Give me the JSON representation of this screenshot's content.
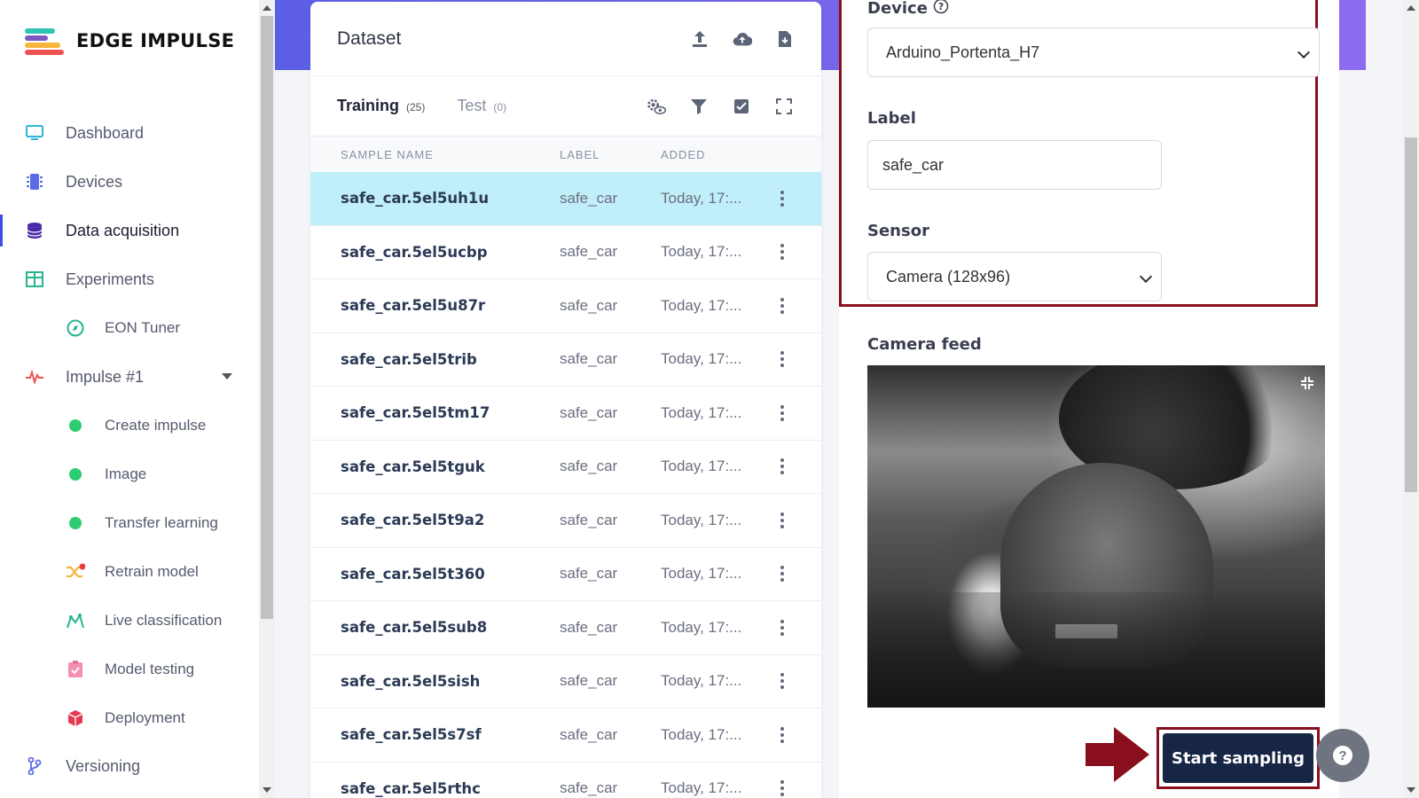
{
  "app": {
    "name": "EDGE IMPULSE"
  },
  "sidebar": {
    "items": [
      {
        "label": "Dashboard",
        "icon": "monitor-icon"
      },
      {
        "label": "Devices",
        "icon": "chip-icon"
      },
      {
        "label": "Data acquisition",
        "icon": "database-icon",
        "active": true
      },
      {
        "label": "Experiments",
        "icon": "table-grid-icon"
      },
      {
        "label": "EON Tuner",
        "icon": "compass-icon"
      },
      {
        "label": "Impulse #1",
        "icon": "pulse-icon"
      },
      {
        "label": "Create impulse",
        "icon": "green-dot-icon"
      },
      {
        "label": "Image",
        "icon": "green-dot-icon"
      },
      {
        "label": "Transfer learning",
        "icon": "green-dot-icon"
      },
      {
        "label": "Retrain model",
        "icon": "shuffle-icon"
      },
      {
        "label": "Live classification",
        "icon": "live-icon"
      },
      {
        "label": "Model testing",
        "icon": "clipboard-check-icon"
      },
      {
        "label": "Deployment",
        "icon": "cube-icon"
      },
      {
        "label": "Versioning",
        "icon": "branch-icon"
      }
    ]
  },
  "dataset": {
    "title": "Dataset",
    "tabs": [
      {
        "label": "Training",
        "count": "(25)"
      },
      {
        "label": "Test",
        "count": "(0)"
      }
    ],
    "columns": [
      "SAMPLE NAME",
      "LABEL",
      "ADDED"
    ],
    "rows": [
      {
        "name": "safe_car.5el5uh1u",
        "label": "safe_car",
        "added": "Today, 17:..."
      },
      {
        "name": "safe_car.5el5ucbp",
        "label": "safe_car",
        "added": "Today, 17:..."
      },
      {
        "name": "safe_car.5el5u87r",
        "label": "safe_car",
        "added": "Today, 17:..."
      },
      {
        "name": "safe_car.5el5trib",
        "label": "safe_car",
        "added": "Today, 17:..."
      },
      {
        "name": "safe_car.5el5tm17",
        "label": "safe_car",
        "added": "Today, 17:..."
      },
      {
        "name": "safe_car.5el5tguk",
        "label": "safe_car",
        "added": "Today, 17:..."
      },
      {
        "name": "safe_car.5el5t9a2",
        "label": "safe_car",
        "added": "Today, 17:..."
      },
      {
        "name": "safe_car.5el5t360",
        "label": "safe_car",
        "added": "Today, 17:..."
      },
      {
        "name": "safe_car.5el5sub8",
        "label": "safe_car",
        "added": "Today, 17:..."
      },
      {
        "name": "safe_car.5el5sish",
        "label": "safe_car",
        "added": "Today, 17:..."
      },
      {
        "name": "safe_car.5el5s7sf",
        "label": "safe_car",
        "added": "Today, 17:..."
      },
      {
        "name": "safe_car.5el5rthc",
        "label": "safe_car",
        "added": "Today, 17:..."
      }
    ]
  },
  "collect": {
    "device_label": "Device",
    "device_value": "Arduino_Portenta_H7",
    "label_label": "Label",
    "label_value": "safe_car",
    "sensor_label": "Sensor",
    "sensor_value": "Camera (128x96)",
    "camera_feed_label": "Camera feed",
    "start_button": "Start sampling"
  },
  "colors": {
    "accent": "#3b4ee8",
    "banner": "#6b62e8",
    "highlight_box": "#8a0f1e",
    "selected_row": "#c0eef9",
    "button": "#182646"
  }
}
